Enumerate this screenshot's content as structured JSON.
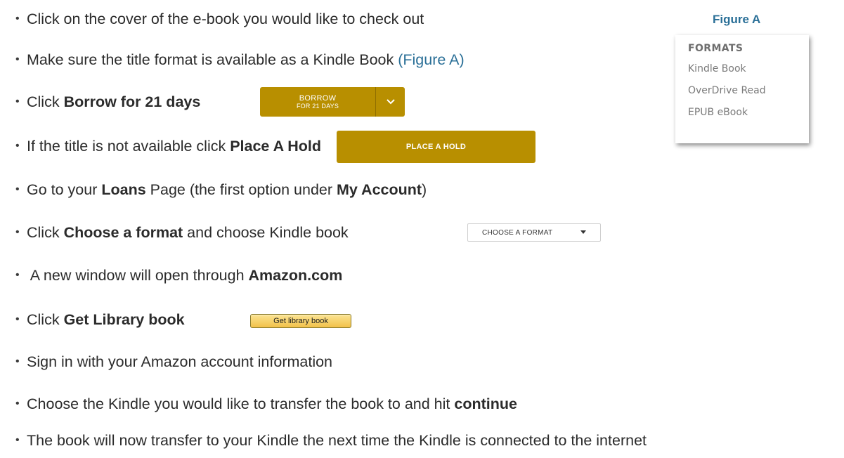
{
  "steps": [
    {
      "bullet": "•",
      "pre": "Click on the cover of the e-book you would like to check out",
      "bold": "",
      "post": "",
      "bold2": "",
      "post2": "",
      "link": ""
    },
    {
      "bullet": "•",
      "pre": "Make sure the title format is available as a Kindle Book ",
      "bold": "",
      "post": "",
      "bold2": "",
      "post2": "",
      "link": "(Figure A)"
    },
    {
      "bullet": "•",
      "pre": "Click ",
      "bold": "Borrow for 21 days",
      "post": "",
      "bold2": "",
      "post2": "",
      "link": ""
    },
    {
      "bullet": "•",
      "pre": "If the title is not available click ",
      "bold": "Place A Hold",
      "post": "",
      "bold2": "",
      "post2": "",
      "link": ""
    },
    {
      "bullet": "•",
      "pre": "Go to your ",
      "bold": "Loans",
      "post": " Page (the first option under ",
      "bold2": "My Account",
      "post2": ")",
      "link": ""
    },
    {
      "bullet": "•",
      "pre": "Click ",
      "bold": "Choose a format",
      "post": " and choose Kindle book",
      "bold2": "",
      "post2": "",
      "link": ""
    },
    {
      "bullet": "•",
      "pre": " A new window will open through ",
      "bold": "Amazon.com",
      "post": "",
      "bold2": "",
      "post2": "",
      "link": ""
    },
    {
      "bullet": "•",
      "pre": "Click ",
      "bold": "Get Library book",
      "post": "",
      "bold2": "",
      "post2": "",
      "link": ""
    },
    {
      "bullet": "•",
      "pre": "Sign in with your Amazon account information",
      "bold": "",
      "post": "",
      "bold2": "",
      "post2": "",
      "link": ""
    },
    {
      "bullet": "•",
      "pre": "Choose the Kindle you would like to transfer the book to and hit ",
      "bold": "continue",
      "post": "",
      "bold2": "",
      "post2": "",
      "link": ""
    },
    {
      "bullet": "•",
      "pre": "The book will now transfer to your Kindle the next time the Kindle is connected to the internet",
      "bold": "",
      "post": "",
      "bold2": "",
      "post2": "",
      "link": ""
    }
  ],
  "buttons": {
    "borrow_line1": "BORROW",
    "borrow_line2": "FOR 21 DAYS",
    "place_hold": "PLACE A HOLD",
    "choose_format": "CHOOSE A FORMAT",
    "get_library_book": "Get library book"
  },
  "figure_a": {
    "caption": "Figure A",
    "heading": "FORMATS",
    "items": [
      "Kindle Book",
      "OverDrive Read",
      "EPUB eBook"
    ]
  },
  "colors": {
    "accent_gold": "#b88f00",
    "link_blue": "#2a6f97"
  }
}
